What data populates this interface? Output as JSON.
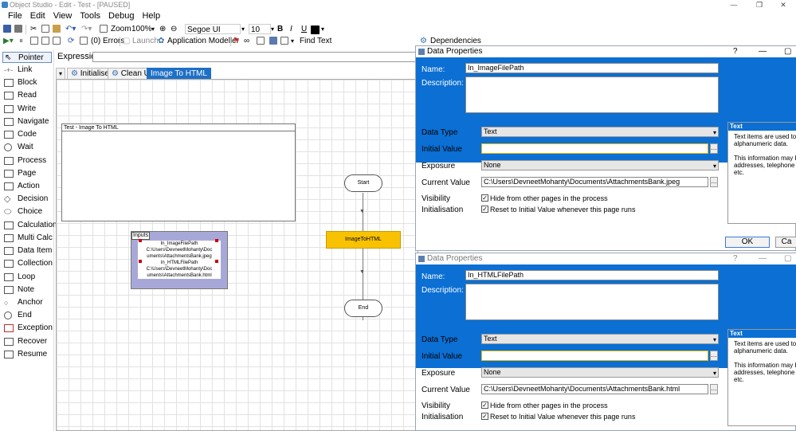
{
  "window": {
    "title": "Object Studio - Edit - Test - [PAUSED]",
    "minimize": "—",
    "restore": "❐",
    "close": "✕"
  },
  "menu": [
    "File",
    "Edit",
    "View",
    "Tools",
    "Debug",
    "Help"
  ],
  "toolbar": {
    "zoom_label": "Zoom",
    "zoom_value": "100%",
    "font_name": "Segoe UI",
    "font_size": "10",
    "bold": "B",
    "italic": "I",
    "underline": "U",
    "errors": "(0) Errors",
    "launch": "Launch",
    "app_modeller": "Application Modeller",
    "find_text": "Find Text",
    "dependencies": "Dependencies"
  },
  "expression": {
    "label": "Expression:",
    "value": ""
  },
  "palette": [
    "Pointer",
    "Link",
    "Block",
    "Read",
    "Write",
    "Navigate",
    "Code",
    "Wait",
    "Process",
    "Page",
    "Action",
    "Decision",
    "Choice",
    "Calculation",
    "Multi Calc",
    "Data Item",
    "Collection",
    "Loop",
    "Note",
    "Anchor",
    "End",
    "Exception",
    "Recover",
    "Resume"
  ],
  "tabs": [
    "Initialise",
    "Clean Up",
    "Image To HTML"
  ],
  "canvas": {
    "block_title": "Test - Image To HTML",
    "inputs_label": "Inputs",
    "inputs_text": [
      "In_ImageFilePath",
      "C:\\Users\\DevneetMohanty\\Doc",
      "uments\\AttachmentsBank.jpeg",
      "In_HTMLFilePath",
      "C:\\Users\\DevneetMohanty\\Doc",
      "uments\\AttachmentsBank.html"
    ],
    "start": "Start",
    "action": "ImageToHTML",
    "end": "End"
  },
  "dialogs": [
    {
      "title": "Data Properties",
      "name_label": "Name:",
      "name": "In_ImageFilePath",
      "desc_label": "Description:",
      "type_label": "Data Type",
      "type": "Text",
      "init_label": "Initial Value",
      "init": "",
      "exposure_label": "Exposure",
      "exposure": "None",
      "current_label": "Current Value",
      "current": "C:\\Users\\DevneetMohanty\\Documents\\AttachmentsBank.jpeg",
      "visibility_label": "Visibility",
      "visibility_text": "Hide from other pages in the process",
      "initialisation_label": "Initialisation",
      "initialisation_text": "Reset to Initial Value whenever this page runs",
      "info_header": "Text",
      "info_lines": [
        "Text items are used to st",
        "alphanumeric data.",
        "",
        "This information may be",
        "addresses, telephone nu",
        "etc."
      ],
      "ok": "OK",
      "cancel": "Ca"
    },
    {
      "title": "Data Properties",
      "name_label": "Name:",
      "name": "In_HTMLFilePath",
      "desc_label": "Description:",
      "type_label": "Data Type",
      "type": "Text",
      "init_label": "Initial Value",
      "init": "",
      "exposure_label": "Exposure",
      "exposure": "None",
      "current_label": "Current Value",
      "current": "C:\\Users\\DevneetMohanty\\Documents\\AttachmentsBank.html",
      "visibility_label": "Visibility",
      "visibility_text": "Hide from other pages in the process",
      "initialisation_label": "Initialisation",
      "initialisation_text": "Reset to Initial Value whenever this page runs",
      "info_header": "Text",
      "info_lines": [
        "Text items are used to st",
        "alphanumeric data.",
        "",
        "This information may be",
        "addresses, telephone nu",
        "etc."
      ]
    }
  ],
  "colors": {
    "accent_blue": "#0b6fd3",
    "action_yellow": "#f9c200",
    "inputs_purple": "#a8a8d8"
  }
}
